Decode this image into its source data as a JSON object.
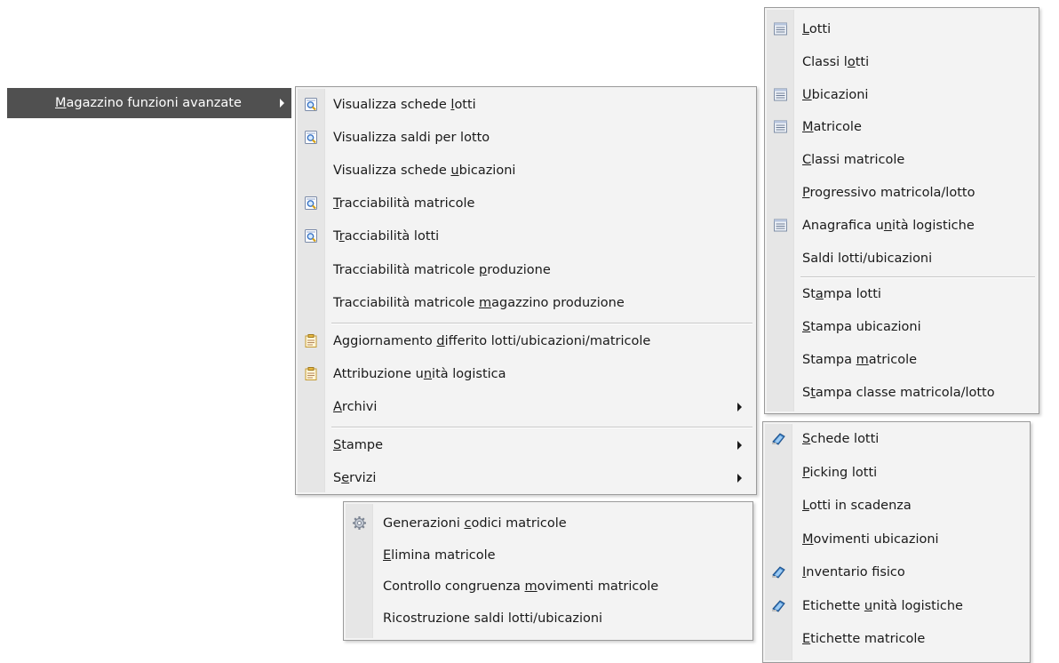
{
  "root": {
    "pre": "",
    "acc": "M",
    "post": "agazzino funzioni avanzate"
  },
  "main_menu": {
    "items": [
      {
        "icon": "search-icon",
        "pre": "Visualizza schede ",
        "acc": "l",
        "post": "otti"
      },
      {
        "icon": "search-icon",
        "pre": "Visualizza saldi per lotto",
        "acc": "",
        "post": ""
      },
      {
        "icon": "",
        "pre": "Visualizza schede ",
        "acc": "u",
        "post": "bicazioni"
      },
      {
        "icon": "search-icon",
        "pre": "",
        "acc": "T",
        "post": "racciabilità matricole"
      },
      {
        "icon": "search-icon",
        "pre": "T",
        "acc": "r",
        "post": "acciabilità lotti"
      },
      {
        "icon": "",
        "pre": "Tracciabilità matricole ",
        "acc": "p",
        "post": "roduzione"
      },
      {
        "icon": "",
        "pre": "Tracciabilità matricole ",
        "acc": "m",
        "post": "agazzino produzione"
      },
      {
        "icon": "document-icon",
        "pre": "Aggiornamento ",
        "acc": "d",
        "post": "ifferito lotti/ubicazioni/matricole"
      },
      {
        "icon": "document-icon",
        "pre": "Attribuzione u",
        "acc": "n",
        "post": "ità logistica"
      },
      {
        "icon": "",
        "pre": "",
        "acc": "A",
        "post": "rchivi",
        "submenu": true
      },
      {
        "icon": "",
        "pre": "",
        "acc": "S",
        "post": "tampe",
        "submenu": true
      },
      {
        "icon": "",
        "pre": "S",
        "acc": "e",
        "post": "rvizi",
        "submenu": true
      }
    ]
  },
  "archivi_menu": {
    "items": [
      {
        "icon": "list-icon",
        "pre": "",
        "acc": "L",
        "post": "otti"
      },
      {
        "icon": "",
        "pre": "Classi l",
        "acc": "o",
        "post": "tti"
      },
      {
        "icon": "list-icon",
        "pre": "",
        "acc": "U",
        "post": "bicazioni"
      },
      {
        "icon": "list-icon",
        "pre": "",
        "acc": "M",
        "post": "atricole"
      },
      {
        "icon": "",
        "pre": "",
        "acc": "C",
        "post": "lassi matricole"
      },
      {
        "icon": "",
        "pre": "",
        "acc": "P",
        "post": "rogressivo matricola/lotto"
      },
      {
        "icon": "list-icon",
        "pre": "Anagrafica u",
        "acc": "n",
        "post": "ità logistiche"
      },
      {
        "icon": "",
        "pre": "Saldi lotti/ubicazioni",
        "acc": "",
        "post": ""
      },
      {
        "icon": "",
        "pre": "St",
        "acc": "a",
        "post": "mpa lotti"
      },
      {
        "icon": "",
        "pre": "",
        "acc": "S",
        "post": "tampa ubicazioni"
      },
      {
        "icon": "",
        "pre": "Stampa ",
        "acc": "m",
        "post": "atricole"
      },
      {
        "icon": "",
        "pre": "S",
        "acc": "t",
        "post": "ampa classe matricola/lotto"
      }
    ]
  },
  "stampe_menu": {
    "items": [
      {
        "icon": "print-icon",
        "pre": "",
        "acc": "S",
        "post": "chede lotti"
      },
      {
        "icon": "",
        "pre": "",
        "acc": "P",
        "post": "icking lotti"
      },
      {
        "icon": "",
        "pre": "",
        "acc": "L",
        "post": "otti in scadenza"
      },
      {
        "icon": "",
        "pre": "",
        "acc": "M",
        "post": "ovimenti ubicazioni"
      },
      {
        "icon": "print-icon",
        "pre": "",
        "acc": "I",
        "post": "nventario fisico"
      },
      {
        "icon": "print-icon",
        "pre": "Etichette ",
        "acc": "u",
        "post": "nità logistiche"
      },
      {
        "icon": "",
        "pre": "",
        "acc": "E",
        "post": "tichette matricole"
      }
    ]
  },
  "servizi_menu": {
    "items": [
      {
        "icon": "gear-icon",
        "pre": "Generazioni ",
        "acc": "c",
        "post": "odici matricole"
      },
      {
        "icon": "",
        "pre": "",
        "acc": "E",
        "post": "limina matricole"
      },
      {
        "icon": "",
        "pre": "Controllo congruenza ",
        "acc": "m",
        "post": "ovimenti matricole"
      },
      {
        "icon": "",
        "pre": "Ricostruzione saldi lotti/ubicazioni",
        "acc": "",
        "post": ""
      }
    ]
  }
}
